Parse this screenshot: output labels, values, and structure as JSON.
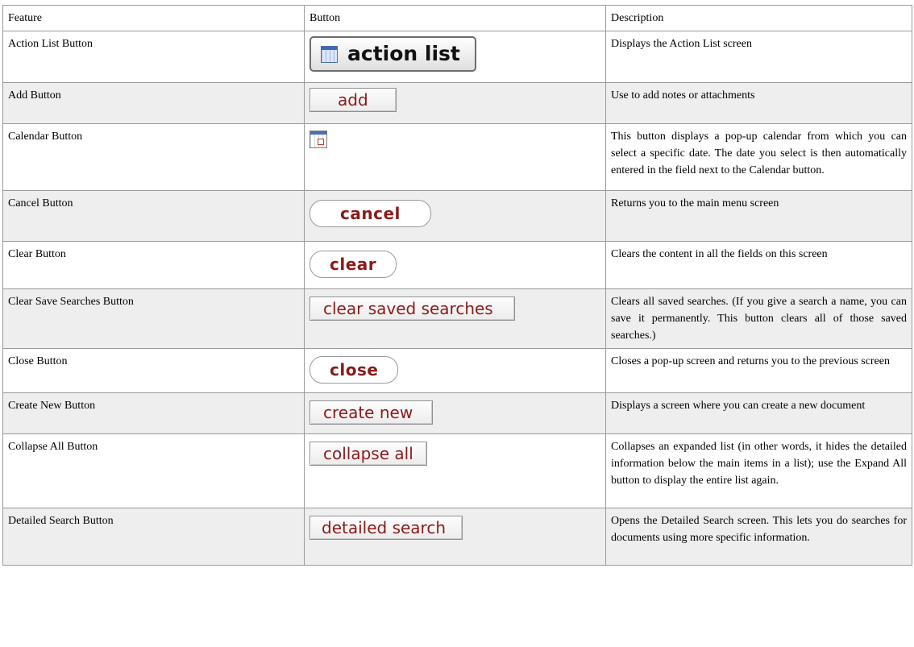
{
  "header": {
    "feature": "Feature",
    "button": "Button",
    "description": "Description"
  },
  "rows": [
    {
      "feature": "Action List Button",
      "button": "action list",
      "description": "Displays the Action List screen"
    },
    {
      "feature": "Add Button",
      "button": "add",
      "description": "Use to add notes or attachments"
    },
    {
      "feature": "Calendar Button",
      "button": "",
      "description": "This button displays a pop-up calendar from which you can select a specific date. The date you select is then automatically entered in the field next to the Calendar button."
    },
    {
      "feature": "Cancel Button",
      "button": "cancel",
      "description": "Returns you to the main menu screen"
    },
    {
      "feature": "Clear Button",
      "button": "clear",
      "description": "Clears the content in all the fields on this screen"
    },
    {
      "feature": "Clear Save Searches Button",
      "button": "clear saved searches",
      "description": "Clears all saved searches. (If you give a search a name, you can save it permanently. This button clears all of those saved searches.)"
    },
    {
      "feature": "Close Button",
      "button": "close",
      "description": "Closes a pop-up screen and returns you to the previous screen"
    },
    {
      "feature": "Create New Button",
      "button": "create new",
      "description": "Displays a screen where you can create a new document"
    },
    {
      "feature": "Collapse All Button",
      "button": "collapse all",
      "description": "Collapses an expanded list (in other words, it hides the detailed information below the main items in a list); use the Expand All button to display the entire list again."
    },
    {
      "feature": "Detailed Search Button",
      "button": "detailed search",
      "description": "Opens the Detailed Search screen. This lets you do searches for documents using more specific information."
    }
  ],
  "icons": {
    "action_list": "table-list-icon",
    "calendar": "calendar-icon"
  },
  "colors": {
    "button_text": "#8b1a1a",
    "shaded_row": "#eeeeee",
    "border": "#9a9a9a"
  }
}
